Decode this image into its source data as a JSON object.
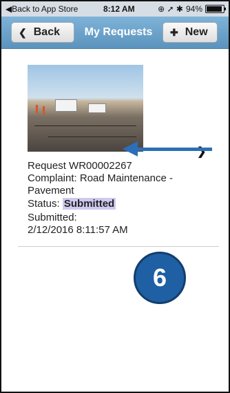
{
  "status_bar": {
    "back_label": "◀Back to App Store",
    "time": "8:12 AM",
    "icons": "⊕ ➚ ✱",
    "battery": "94%",
    "battery_level": 0.94
  },
  "nav": {
    "back_label": "Back",
    "title": "My Requests",
    "new_label": "New"
  },
  "requests": [
    {
      "id_line": "Request WR00002267",
      "complaint_line1": "Complaint: Road Maintenance -",
      "complaint_line2": "Pavement",
      "status_label": "Status:",
      "status_value": "Submitted",
      "submitted_label": "Submitted:",
      "submitted_value": "2/12/2016 8:11:57 AM"
    }
  ],
  "annotation": {
    "step_number": "6",
    "arrow_color": "#2c6fb8",
    "badge_color": "#1f5fa3"
  }
}
